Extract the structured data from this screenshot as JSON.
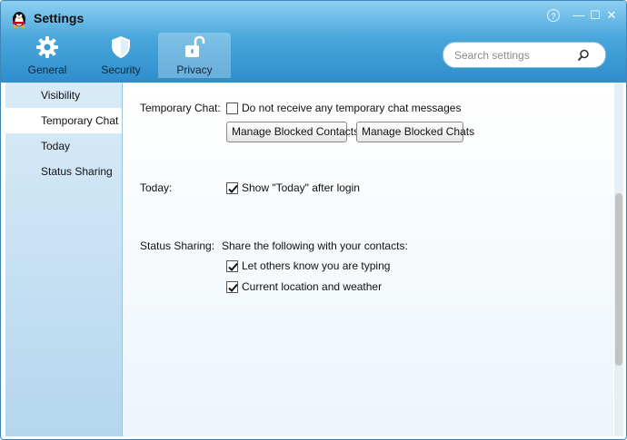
{
  "window": {
    "title": "Settings",
    "controls": {
      "help": "?",
      "minimize": "—",
      "maximize": "☐",
      "close": "✕"
    }
  },
  "nav_tabs": [
    {
      "label": "General",
      "icon": "gear-icon"
    },
    {
      "label": "Security",
      "icon": "shield-icon"
    },
    {
      "label": "Privacy",
      "icon": "unlock-icon",
      "active": true
    }
  ],
  "search": {
    "placeholder": "Search settings",
    "value": ""
  },
  "sidebar": {
    "items": [
      {
        "label": "Visibility"
      },
      {
        "label": "Temporary Chat",
        "active": true
      },
      {
        "label": "Today"
      },
      {
        "label": "Status Sharing"
      }
    ]
  },
  "temporary_chat": {
    "label": "Temporary Chat:",
    "option_label": "Do not receive any temporary chat messages",
    "option_checked": false,
    "manage_contacts_label": "Manage Blocked Contacts",
    "manage_chats_label": "Manage Blocked Chats"
  },
  "today": {
    "label": "Today:",
    "option_label": "Show \"Today\" after login",
    "option_checked": true
  },
  "status_sharing": {
    "label": "Status Sharing:",
    "description": "Share the following with your contacts:",
    "options": [
      {
        "label": "Let others know you are typing",
        "checked": true
      },
      {
        "label": "Current location and weather",
        "checked": true
      }
    ]
  },
  "colors": {
    "header_top": "#8dd0f2",
    "header_bottom": "#2e8dcb",
    "sidebar": "#c8e1f3",
    "accent": "#3f86b8"
  }
}
